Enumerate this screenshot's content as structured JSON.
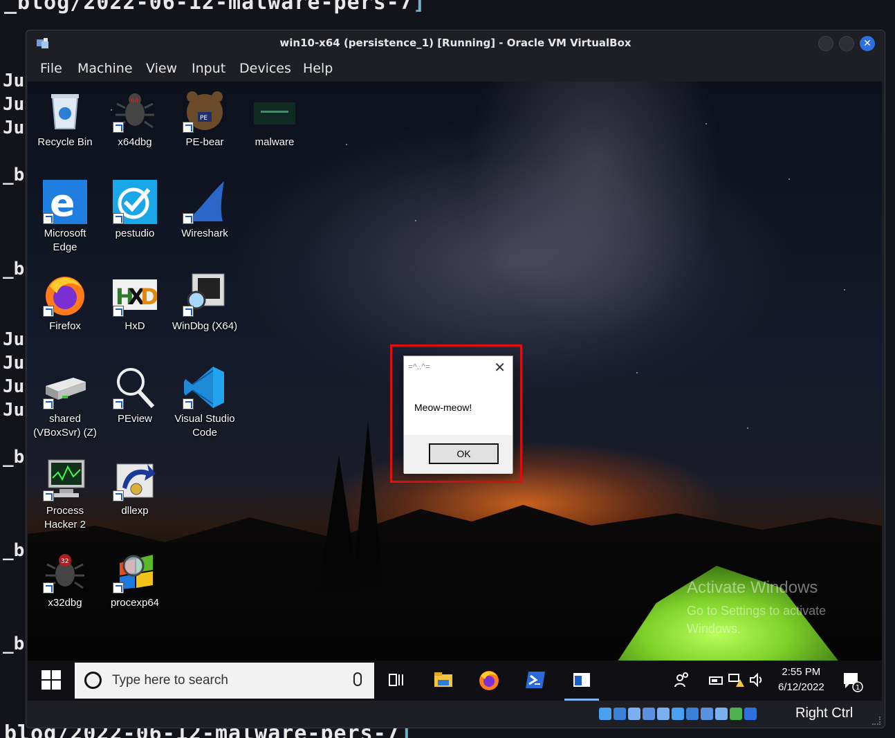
{
  "host_terminal": {
    "top_line": "_blog/2022-06-12-malware-pers-7",
    "bottom_line": "blog/2022-06-12-malware-pers-7",
    "bracket": "]",
    "left_fragments": [
      "Ju",
      "Ju",
      "Ju",
      "_b",
      "_b",
      "Ju",
      "Ju",
      "Ju",
      "Ju",
      "_b",
      "_b",
      "_b"
    ]
  },
  "vbox": {
    "title": "win10-x64 (persistence_1) [Running] - Oracle VM VirtualBox",
    "menu": [
      "File",
      "Machine",
      "View",
      "Input",
      "Devices",
      "Help"
    ],
    "host_key": "Right Ctrl"
  },
  "desktop": {
    "icons": [
      {
        "label": "Recycle Bin",
        "icon": "recycle-bin-icon"
      },
      {
        "label": "x64dbg",
        "icon": "x64dbg-icon"
      },
      {
        "label": "PE-bear",
        "icon": "pe-bear-icon"
      },
      {
        "label": "malware",
        "icon": "folder-icon"
      },
      {
        "label": "Microsoft Edge",
        "icon": "edge-icon"
      },
      {
        "label": "pestudio",
        "icon": "pestudio-icon"
      },
      {
        "label": "Wireshark",
        "icon": "wireshark-icon"
      },
      {
        "label": "Firefox",
        "icon": "firefox-icon"
      },
      {
        "label": "HxD",
        "icon": "hxd-icon"
      },
      {
        "label": "WinDbg (X64)",
        "icon": "windbg-icon"
      },
      {
        "label": "shared (VBoxSvr) (Z)",
        "icon": "network-drive-icon"
      },
      {
        "label": "PEview",
        "icon": "peview-icon"
      },
      {
        "label": "Visual Studio Code",
        "icon": "vscode-icon"
      },
      {
        "label": "Process Hacker 2",
        "icon": "process-hacker-icon"
      },
      {
        "label": "dllexp",
        "icon": "dllexp-icon"
      },
      {
        "label": "x32dbg",
        "icon": "x32dbg-icon"
      },
      {
        "label": "procexp64",
        "icon": "procexp-icon"
      }
    ]
  },
  "dialog": {
    "title": "=^..^=",
    "message": "Meow-meow!",
    "ok_label": "OK",
    "close_glyph": "✕"
  },
  "watermark": {
    "line1": "Activate Windows",
    "line2": "Go to Settings to activate",
    "line3": "Windows."
  },
  "taskbar": {
    "search_placeholder": "Type here to search",
    "time": "2:55 PM",
    "date": "6/12/2022",
    "notification_count": "1",
    "pinned": [
      "task-view",
      "file-explorer",
      "firefox",
      "powershell",
      "virtualbox-app"
    ]
  },
  "colors": {
    "highlight": "#e01010",
    "accent": "#2f6fe0",
    "tent": "#7fd12a"
  }
}
